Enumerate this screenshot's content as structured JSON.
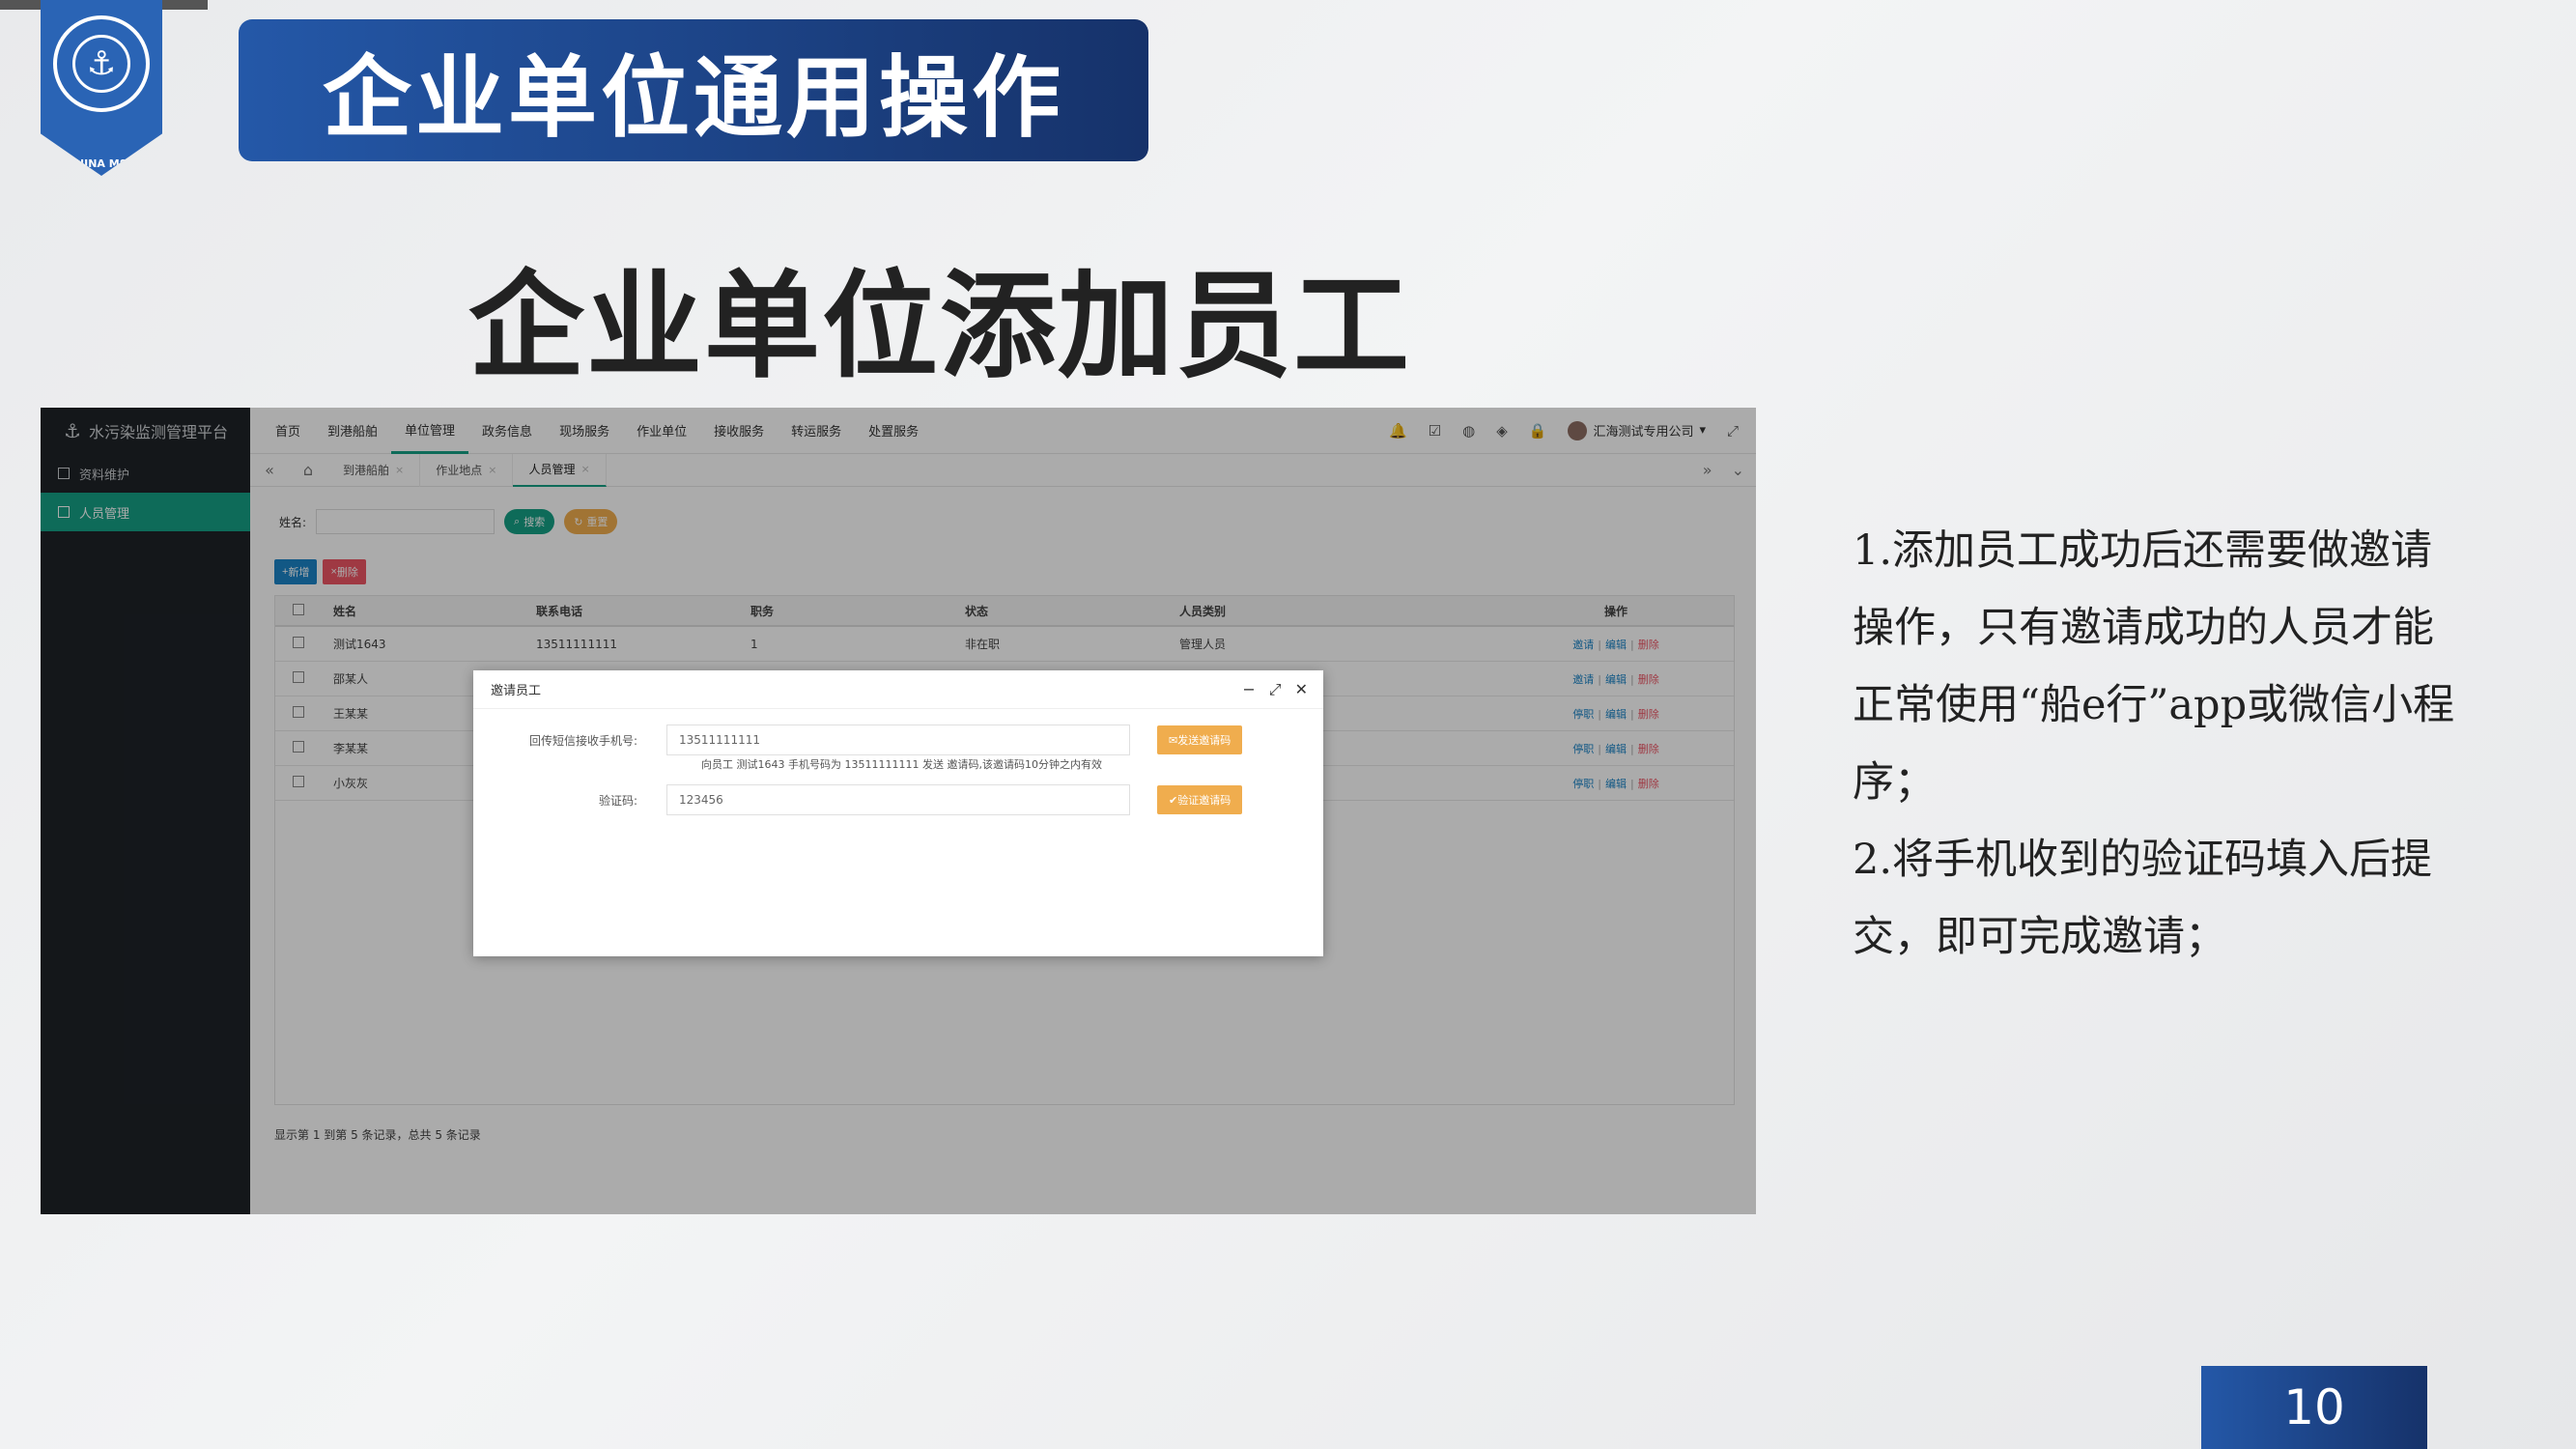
{
  "slide": {
    "title": "企业单位通用操作",
    "subtitle": "企业单位添加员工",
    "logo_text": "CHINA MSA",
    "notes": [
      "1.添加员工成功后还需要做邀请操作，只有邀请成功的人员才能正常使用“船e行”app或微信小程序；",
      "2.将手机收到的验证码填入后提交，即可完成邀请；"
    ],
    "page_number": "10"
  },
  "app": {
    "brand": "水污染监测管理平台",
    "sidebar": [
      {
        "label": "资料维护",
        "active": false
      },
      {
        "label": "人员管理",
        "active": true
      }
    ],
    "nav": [
      {
        "label": "首页",
        "active": false
      },
      {
        "label": "到港船舶",
        "active": false
      },
      {
        "label": "单位管理",
        "active": true
      },
      {
        "label": "政务信息",
        "active": false
      },
      {
        "label": "现场服务",
        "active": false
      },
      {
        "label": "作业单位",
        "active": false
      },
      {
        "label": "接收服务",
        "active": false
      },
      {
        "label": "转运服务",
        "active": false
      },
      {
        "label": "处置服务",
        "active": false
      }
    ],
    "user_name": "汇海测试专用公司",
    "tabs": [
      {
        "label": "到港船舶",
        "active": false
      },
      {
        "label": "作业地点",
        "active": false
      },
      {
        "label": "人员管理",
        "active": true
      }
    ],
    "search": {
      "label": "姓名:",
      "search_btn": "搜索",
      "reset_btn": "重置"
    },
    "actions": {
      "add": "新增",
      "delete": "删除"
    },
    "table": {
      "headers": [
        "姓名",
        "联系电话",
        "职务",
        "状态",
        "人员类别",
        "操作"
      ],
      "rows": [
        {
          "name": "测试1643",
          "phone": "13511111111",
          "title": "1",
          "status": "非在职",
          "category": "管理人员",
          "op1": "邀请",
          "op2": "编辑",
          "op3": "删除"
        },
        {
          "name": "邵某人",
          "phone": "",
          "title": "",
          "status": "",
          "category": "",
          "op1": "邀请",
          "op2": "编辑",
          "op3": "删除"
        },
        {
          "name": "王某某",
          "phone": "",
          "title": "",
          "status": "",
          "category": "",
          "op1": "停职",
          "op2": "编辑",
          "op3": "删除"
        },
        {
          "name": "李某某",
          "phone": "",
          "title": "",
          "status": "",
          "category": "",
          "op1": "停职",
          "op2": "编辑",
          "op3": "删除"
        },
        {
          "name": "小灰灰",
          "phone": "",
          "title": "",
          "status": "",
          "category": "",
          "op1": "停职",
          "op2": "编辑",
          "op3": "删除"
        }
      ]
    },
    "footer": "显示第 1 到第 5 条记录，总共 5 条记录",
    "modal": {
      "title": "邀请员工",
      "phone_label": "回传短信接收手机号:",
      "phone_value": "13511111111",
      "send_btn": "发送邀请码",
      "hint": "向员工 测试1643 手机号码为 13511111111 发送 邀请码,该邀请码10分钟之内有效",
      "code_label": "验证码:",
      "code_value": "123456",
      "verify_btn": "验证邀请码"
    }
  }
}
